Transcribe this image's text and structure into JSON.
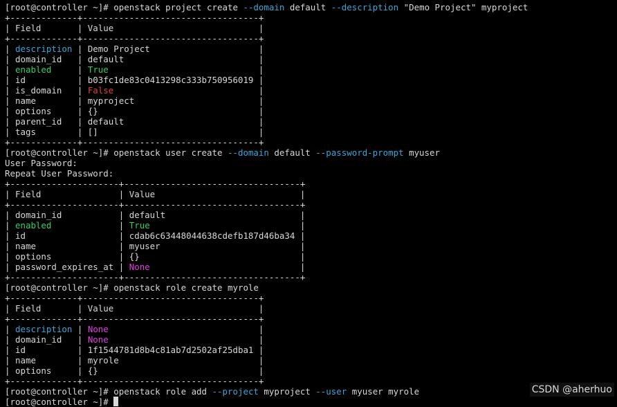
{
  "palette": {
    "background": "#000000",
    "text": "#d8d8d8",
    "option_flag": "#3aa6d8",
    "true_value": "#2fd06a",
    "false_value": "#e0404a",
    "none_value": "#e53ee0"
  },
  "watermark": "CSDN @aherhuo",
  "lines": [
    [
      [
        "plain",
        "[root@controller ~]# openstack project create "
      ],
      [
        "cyan",
        "--domain"
      ],
      [
        "plain",
        " default "
      ],
      [
        "cyan",
        "--description"
      ],
      [
        "plain",
        " \"Demo Project\" myproject"
      ]
    ],
    [
      [
        "plain",
        "+-------------+----------------------------------+"
      ]
    ],
    [
      [
        "plain",
        "| Field       | Value                            |"
      ]
    ],
    [
      [
        "plain",
        "+-------------+----------------------------------+"
      ]
    ],
    [
      [
        "plain",
        "| "
      ],
      [
        "cyan",
        "description"
      ],
      [
        "plain",
        " | Demo Project                     |"
      ]
    ],
    [
      [
        "plain",
        "| domain_id   | default                          |"
      ]
    ],
    [
      [
        "plain",
        "| "
      ],
      [
        "green",
        "enabled"
      ],
      [
        "plain",
        "     | "
      ],
      [
        "green",
        "True"
      ],
      [
        "plain",
        "                             |"
      ]
    ],
    [
      [
        "plain",
        "| id          | b03fc1de83c0413298c333b750956019 |"
      ]
    ],
    [
      [
        "plain",
        "| is_domain   | "
      ],
      [
        "red",
        "False"
      ],
      [
        "plain",
        "                            |"
      ]
    ],
    [
      [
        "plain",
        "| name        | myproject                        |"
      ]
    ],
    [
      [
        "plain",
        "| options     | {}                               |"
      ]
    ],
    [
      [
        "plain",
        "| parent_id   | default                          |"
      ]
    ],
    [
      [
        "plain",
        "| tags        | []                               |"
      ]
    ],
    [
      [
        "plain",
        "+-------------+----------------------------------+"
      ]
    ],
    [
      [
        "plain",
        "[root@controller ~]# openstack user create "
      ],
      [
        "cyan",
        "--domain"
      ],
      [
        "plain",
        " default "
      ],
      [
        "cyan",
        "--password-prompt"
      ],
      [
        "plain",
        " myuser"
      ]
    ],
    [
      [
        "plain",
        "User Password:"
      ]
    ],
    [
      [
        "plain",
        "Repeat User Password:"
      ]
    ],
    [
      [
        "plain",
        "+---------------------+----------------------------------+"
      ]
    ],
    [
      [
        "plain",
        "| Field               | Value                            |"
      ]
    ],
    [
      [
        "plain",
        "+---------------------+----------------------------------+"
      ]
    ],
    [
      [
        "plain",
        "| domain_id           | default                          |"
      ]
    ],
    [
      [
        "plain",
        "| "
      ],
      [
        "green",
        "enabled"
      ],
      [
        "plain",
        "             | "
      ],
      [
        "green",
        "True"
      ],
      [
        "plain",
        "                             |"
      ]
    ],
    [
      [
        "plain",
        "| id                  | cdab6c63448044638cdefb187d46ba34 |"
      ]
    ],
    [
      [
        "plain",
        "| name                | myuser                           |"
      ]
    ],
    [
      [
        "plain",
        "| options             | {}                               |"
      ]
    ],
    [
      [
        "plain",
        "| password_expires_at | "
      ],
      [
        "magenta",
        "None"
      ],
      [
        "plain",
        "                             |"
      ]
    ],
    [
      [
        "plain",
        "+---------------------+----------------------------------+"
      ]
    ],
    [
      [
        "plain",
        "[root@controller ~]# openstack role create myrole"
      ]
    ],
    [
      [
        "plain",
        "+-------------+----------------------------------+"
      ]
    ],
    [
      [
        "plain",
        "| Field       | Value                            |"
      ]
    ],
    [
      [
        "plain",
        "+-------------+----------------------------------+"
      ]
    ],
    [
      [
        "plain",
        "| "
      ],
      [
        "cyan",
        "description"
      ],
      [
        "plain",
        " | "
      ],
      [
        "magenta",
        "None"
      ],
      [
        "plain",
        "                             |"
      ]
    ],
    [
      [
        "plain",
        "| domain_id   | "
      ],
      [
        "magenta",
        "None"
      ],
      [
        "plain",
        "                             |"
      ]
    ],
    [
      [
        "plain",
        "| id          | 1f1544781d8b4c81ab7d2502af25dba1 |"
      ]
    ],
    [
      [
        "plain",
        "| name        | myrole                           |"
      ]
    ],
    [
      [
        "plain",
        "| options     | {}                               |"
      ]
    ],
    [
      [
        "plain",
        "+-------------+----------------------------------+"
      ]
    ],
    [
      [
        "plain",
        "[root@controller ~]# openstack role add "
      ],
      [
        "cyan",
        "--project"
      ],
      [
        "plain",
        " myproject "
      ],
      [
        "cyan",
        "--user"
      ],
      [
        "plain",
        " myuser myrole"
      ]
    ],
    [
      [
        "plain",
        "[root@controller ~]# "
      ]
    ]
  ]
}
